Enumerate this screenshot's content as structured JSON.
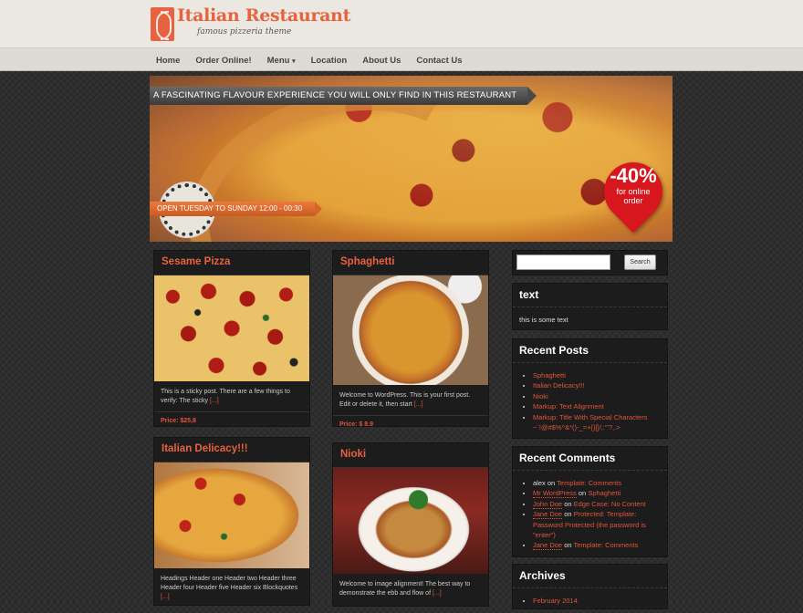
{
  "header": {
    "logo_title": "Italian Restaurant",
    "logo_subtitle": "famous pizzeria theme"
  },
  "nav": {
    "items": [
      "Home",
      "Order Online!",
      "Menu",
      "Location",
      "About Us",
      "Contact Us"
    ],
    "menu_caret": "▾"
  },
  "hero": {
    "banner": "A FASCINATING FLAVOUR EXPERIENCE YOU WILL ONLY FIND IN THIS RESTAURANT",
    "hours": "OPEN   TUESDAY TO SUNDAY 12:00 - 00:30",
    "discount_pct": "-40%",
    "discount_text_1": "for online",
    "discount_text_2": "order"
  },
  "posts": [
    {
      "title": "Sesame Pizza",
      "excerpt": "This is a sticky post. There are a few things to verify: The sticky",
      "more": "[...]",
      "price": "Price: $25,8"
    },
    {
      "title": "Sphaghetti",
      "excerpt": "Welcome to WordPress. This is your first post. Edit or delete it, then start",
      "more": "[...]",
      "price": "Price: $ 8.9"
    },
    {
      "title": "Italian Delicacy!!!",
      "excerpt": "Headings Header one Header two Header three Header four Header five Header six Blockquotes",
      "more": "[...]"
    },
    {
      "title": "Nioki",
      "excerpt": "Welcome to image alignment! The best way to demonstrate the ebb and flow of",
      "more": "[...]"
    }
  ],
  "sidebar": {
    "search_button": "Search",
    "search_value": "",
    "text_widget": {
      "title": "text",
      "body": "this is some text"
    },
    "recent_posts": {
      "title": "Recent Posts",
      "items": [
        "Sphaghetti",
        "Italian Delicacy!!!",
        "Nioki",
        "Markup: Text Alignment",
        "Markup: Title With Special Characters ~`!@#$%^&*()-_=+{}[]/;:'\"?,.>"
      ]
    },
    "recent_comments": {
      "title": "Recent Comments",
      "items": [
        {
          "author": "alex",
          "on": "on",
          "post": "Template: Comments"
        },
        {
          "author": "Mr WordPress",
          "on": "on",
          "post": "Sphaghetti"
        },
        {
          "author": "John Doe",
          "on": "on",
          "post": "Edge Case: No Content"
        },
        {
          "author": "Jane Doe",
          "on": "on",
          "post": "Protected: Template: Password Protected (the password is \"enter\")"
        },
        {
          "author": "Jane Doe",
          "on": "on",
          "post": "Template: Comments"
        }
      ]
    },
    "archives": {
      "title": "Archives",
      "items": [
        "February 2014"
      ]
    }
  },
  "colors": {
    "accent": "#e0553a",
    "header_bg": "#eae8e0",
    "card_bg": "#1c1c1c"
  }
}
